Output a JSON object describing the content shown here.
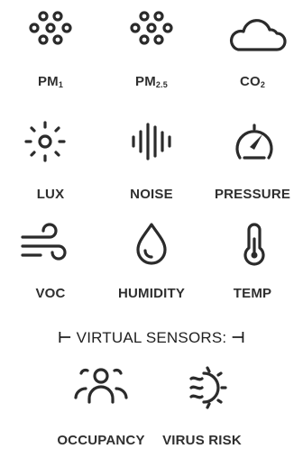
{
  "tiles": [
    {
      "label": "PM",
      "sub": "1",
      "icon": "particles-icon"
    },
    {
      "label": "PM",
      "sub": "2.5",
      "icon": "particles-icon"
    },
    {
      "label": "CO",
      "sub": "2",
      "icon": "cloud-icon"
    },
    {
      "label": "LUX",
      "icon": "sun-icon"
    },
    {
      "label": "NOISE",
      "icon": "sound-wave-icon"
    },
    {
      "label": "PRESSURE",
      "icon": "gauge-icon"
    },
    {
      "label": "VOC",
      "icon": "wind-icon"
    },
    {
      "label": "HUMIDITY",
      "icon": "droplet-icon"
    },
    {
      "label": "TEMP",
      "icon": "thermometer-icon"
    }
  ],
  "virtual_sensors": {
    "heading": "VIRTUAL SENSORS:",
    "left_mark": "⊢",
    "right_mark": "⊣",
    "tiles": [
      {
        "label": "OCCUPANCY",
        "icon": "people-group-icon"
      },
      {
        "label": "VIRUS RISK",
        "icon": "virus-sun-icon"
      }
    ]
  }
}
